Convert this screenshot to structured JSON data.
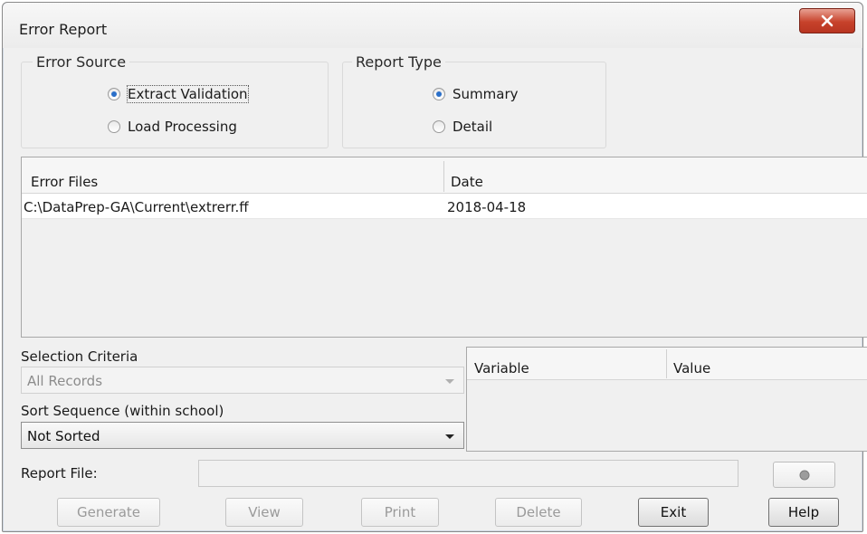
{
  "window": {
    "title": "Error Report"
  },
  "error_source": {
    "legend": "Error Source",
    "options": [
      {
        "label": "Extract Validation",
        "selected": true
      },
      {
        "label": "Load Processing",
        "selected": false
      }
    ]
  },
  "report_type": {
    "legend": "Report Type",
    "options": [
      {
        "label": "Summary",
        "selected": true
      },
      {
        "label": "Detail",
        "selected": false
      }
    ]
  },
  "error_files": {
    "columns": [
      "Error Files",
      "Date"
    ],
    "rows": [
      {
        "file": "C:\\DataPrep-GA\\Current\\extrerr.ff",
        "date": "2018-04-18"
      }
    ]
  },
  "selection_criteria": {
    "label": "Selection Criteria",
    "value": "All Records",
    "enabled": false
  },
  "sort_sequence": {
    "label": "Sort Sequence (within school)",
    "value": "Not Sorted",
    "enabled": true
  },
  "variables_table": {
    "columns": [
      "Variable",
      "Value"
    ]
  },
  "report_file": {
    "label": "Report File:",
    "value": ""
  },
  "buttons": {
    "generate": "Generate",
    "view": "View",
    "print": "Print",
    "delete": "Delete",
    "exit": "Exit",
    "help": "Help"
  },
  "icons": {
    "close": "close-icon",
    "browse": "browse-icon"
  },
  "colors": {
    "close_button": "#c7422b",
    "radio_dot": "#2a6fc9"
  }
}
